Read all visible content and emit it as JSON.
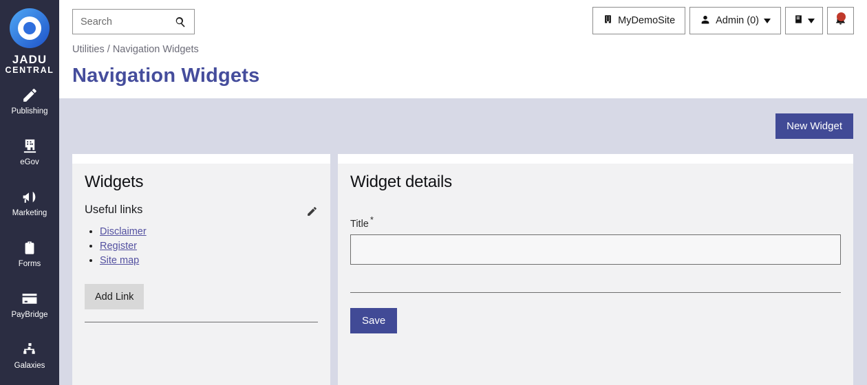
{
  "brand": {
    "logo_icon": "jadu-ring-logo",
    "name_line1": "JADU",
    "name_line2": "CENTRAL",
    "sidebar_bg": "#2b2d42",
    "accent": "#414a96",
    "title_color": "#454d9c",
    "link_color": "#5350a0",
    "notification_color": "#c0392b"
  },
  "sidebar": {
    "items": [
      {
        "label": "Publishing",
        "icon": "pencil-icon"
      },
      {
        "label": "eGov",
        "icon": "building-icon"
      },
      {
        "label": "Marketing",
        "icon": "megaphone-icon"
      },
      {
        "label": "Forms",
        "icon": "clipboard-check-icon"
      },
      {
        "label": "PayBridge",
        "icon": "credit-card-icon"
      },
      {
        "label": "Galaxies",
        "icon": "sitemap-icon"
      }
    ]
  },
  "header": {
    "search": {
      "placeholder": "Search",
      "value": "",
      "icon": "search-icon"
    },
    "site_button": {
      "label": "MyDemoSite",
      "icon": "building-icon"
    },
    "account_button": {
      "label": "Admin (0)",
      "icon": "user-icon",
      "caret": "chevron-down-icon"
    },
    "docs_button": {
      "icon": "book-icon",
      "caret": "chevron-down-icon"
    },
    "notifications_button": {
      "icon": "bell-icon",
      "badge": true
    }
  },
  "breadcrumb": "Utilities / Navigation Widgets",
  "page_title": "Navigation Widgets",
  "toolbar": {
    "new_widget_label": "New Widget"
  },
  "widgets_panel": {
    "heading": "Widgets",
    "group": {
      "title": "Useful links",
      "edit_icon": "pencil-icon",
      "links": [
        {
          "label": "Disclaimer"
        },
        {
          "label": "Register"
        },
        {
          "label": "Site map"
        }
      ],
      "add_link_label": "Add Link"
    }
  },
  "details_panel": {
    "heading": "Widget details",
    "title_field": {
      "label": "Title",
      "required_marker": "*",
      "value": "",
      "placeholder": ""
    },
    "save_label": "Save"
  }
}
